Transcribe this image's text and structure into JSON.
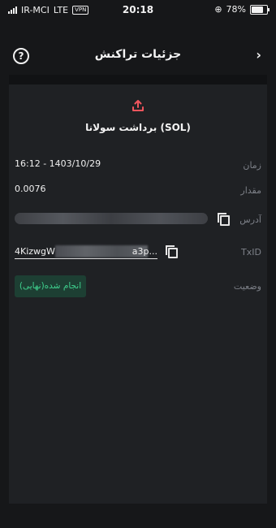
{
  "status_bar": {
    "carrier": "IR-MCI",
    "network": "LTE",
    "vpn": "VPN",
    "time": "20:18",
    "battery": "78%",
    "battery_level": 0.78
  },
  "header": {
    "title": "جزئیات تراکنش",
    "help_symbol": "?",
    "back_symbol": "›"
  },
  "transaction": {
    "title": "برداشت سولانا (SOL)",
    "icon": "upload-icon",
    "icon_color": "#f0555d",
    "rows": {
      "time_label": "زمان",
      "time_value": "16:12 - 1403/10/29",
      "amount_label": "مقدار",
      "amount_value": "0.0076",
      "address_label": "آدرس",
      "txid_label": "TxID",
      "txid_start": "4KizwgW",
      "txid_end": "a3p...",
      "status_label": "وضعیت",
      "status_value": "انجام شده(نهایی)"
    }
  }
}
